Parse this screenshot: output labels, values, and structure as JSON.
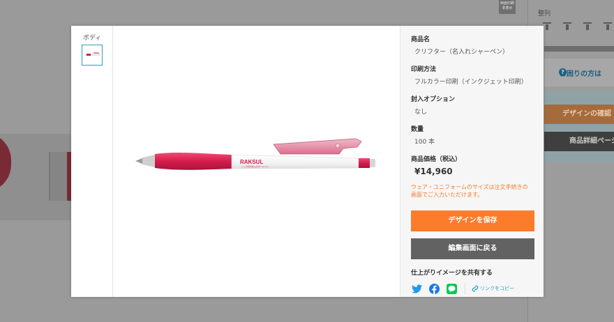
{
  "background": {
    "print_badge": "両面印刷\n非表示",
    "align_label": "整列",
    "help_text": "お困りの方は",
    "design_confirm_button": "デザインの確認",
    "product_detail_button": "商品詳細ページ"
  },
  "modal": {
    "thumbnail_label": "ボディ",
    "pen": {
      "brand": "RAKSUL",
      "tagline": "ノック式の名入れボールペン",
      "colors": {
        "grip": "#d51d4c",
        "clip": "#e08aa3",
        "body": "#ffffff"
      }
    },
    "info": {
      "product_name_label": "商品名",
      "product_name": "クリフター（名入れシャーペン）",
      "print_method_label": "印刷方法",
      "print_method": "フルカラー印刷（インクジェット印刷）",
      "option_label": "封入オプション",
      "option": "なし",
      "quantity_label": "数量",
      "quantity": "100 本",
      "price_label": "商品価格（税込）",
      "price": "¥14,960",
      "note": "ウェア・ユニフォームのサイズは注文手続きの画面でご入力いただけます。",
      "save_button": "デザインを保存",
      "back_button": "編集画面に戻る",
      "share_title": "仕上がりイメージを共有する",
      "copy_link": "リンクをコピー"
    },
    "share_icons": [
      "twitter-icon",
      "facebook-icon",
      "line-icon"
    ],
    "colors": {
      "accent": "#fd7c2c",
      "secondary": "#626262",
      "link": "#2aa0b8"
    }
  }
}
